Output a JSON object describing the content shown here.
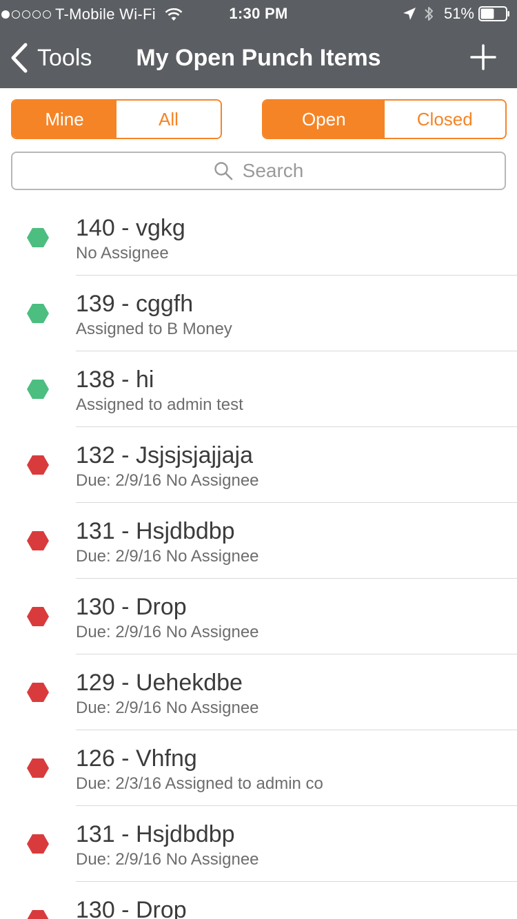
{
  "status_bar": {
    "carrier": "T-Mobile Wi-Fi",
    "time": "1:30 PM",
    "battery": "51%",
    "signal_dots_filled": 1,
    "signal_dots_total": 5,
    "battery_level": 0.51
  },
  "nav": {
    "back_label": "Tools",
    "title": "My Open Punch Items",
    "add_icon": "plus-icon"
  },
  "filters": {
    "owner": {
      "options": [
        "Mine",
        "All"
      ],
      "selected": "Mine"
    },
    "state": {
      "options": [
        "Open",
        "Closed"
      ],
      "selected": "Open"
    }
  },
  "search": {
    "placeholder": "Search"
  },
  "colors": {
    "header_bg": "#5b5e62",
    "accent": "#f58426",
    "status_ok": "#4cbe80",
    "status_overdue": "#d93b3d"
  },
  "items": [
    {
      "title": "140 - vgkg",
      "subtitle": "No Assignee",
      "status": "green"
    },
    {
      "title": "139 - cggfh",
      "subtitle": "Assigned to B Money",
      "status": "green"
    },
    {
      "title": "138 - hi",
      "subtitle": "Assigned to admin test",
      "status": "green"
    },
    {
      "title": "132 - Jsjsjsjajjaja",
      "subtitle": "Due: 2/9/16 No Assignee",
      "status": "red"
    },
    {
      "title": "131 - Hsjdbdbp",
      "subtitle": "Due: 2/9/16 No Assignee",
      "status": "red"
    },
    {
      "title": "130 - Drop",
      "subtitle": "Due: 2/9/16 No Assignee",
      "status": "red"
    },
    {
      "title": "129 - Uehekdbe",
      "subtitle": "Due: 2/9/16 No Assignee",
      "status": "red"
    },
    {
      "title": "126 - Vhfng",
      "subtitle": "Due: 2/3/16 Assigned to admin co",
      "status": "red"
    },
    {
      "title": "131 - Hsjdbdbp",
      "subtitle": "Due: 2/9/16 No Assignee",
      "status": "red"
    },
    {
      "title": "130 - Drop",
      "subtitle": "",
      "status": "red"
    }
  ]
}
